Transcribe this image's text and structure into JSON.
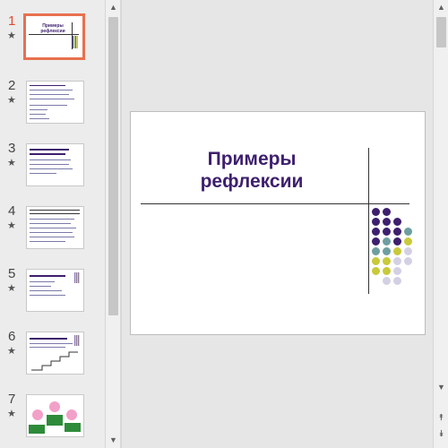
{
  "thumbnails": [
    {
      "num": "1",
      "title": "Примеры рефлексии"
    },
    {
      "num": "2"
    },
    {
      "num": "3"
    },
    {
      "num": "4"
    },
    {
      "num": "5"
    },
    {
      "num": "6"
    },
    {
      "num": "7"
    }
  ],
  "slide": {
    "title": "Примеры\nрефлексии"
  },
  "colors": {
    "accent_selected": "#e8704e",
    "title": "#3d1f6e",
    "dot_purple": "#3d1f6e",
    "dot_teal": "#6e9ea0",
    "dot_yellow": "#c9c93a",
    "dot_lavender": "#d4d0e4"
  },
  "icons": {
    "star": "★",
    "scroll_up": "▲",
    "scroll_down": "▼",
    "prev_slide": "⯭",
    "next_slide": "⯯"
  }
}
